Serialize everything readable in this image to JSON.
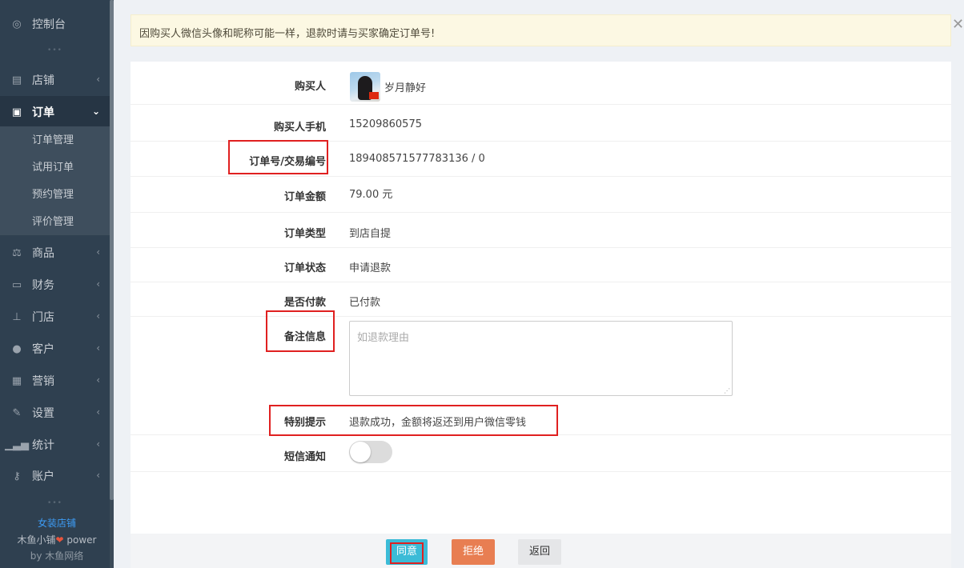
{
  "sidebar": {
    "dashboard": "控制台",
    "items": [
      {
        "label": "店铺",
        "icon": "shop-icon"
      },
      {
        "label": "订单",
        "icon": "money-icon"
      },
      {
        "label": "商品",
        "icon": "scale-icon"
      },
      {
        "label": "财务",
        "icon": "cash-icon"
      },
      {
        "label": "门店",
        "icon": "sitemap-icon"
      },
      {
        "label": "客户",
        "icon": "users-icon"
      },
      {
        "label": "营销",
        "icon": "gift-icon"
      },
      {
        "label": "设置",
        "icon": "wrench-icon"
      },
      {
        "label": "统计",
        "icon": "signal-icon"
      },
      {
        "label": "账户",
        "icon": "key-icon"
      }
    ],
    "order_submenu": [
      "订单管理",
      "试用订单",
      "预约管理",
      "评价管理"
    ],
    "store_name": "女装店铺",
    "power_prefix": "木鱼小铺",
    "power_suffix": " power",
    "by": "by 木鱼网络"
  },
  "notice": "因购买人微信头像和昵称可能一样，退款时请与买家确定订单号!",
  "form": {
    "buyer_label": "购买人",
    "buyer_name": "岁月静好",
    "phone_label": "购买人手机",
    "phone": "15209860575",
    "order_no_label": "订单号/交易编号",
    "order_no": "189408571577783136 / 0",
    "amount_label": "订单金额",
    "amount": "79.00 元",
    "type_label": "订单类型",
    "type": "到店自提",
    "status_label": "订单状态",
    "status": "申请退款",
    "paid_label": "是否付款",
    "paid": "已付款",
    "remark_label": "备注信息",
    "remark_placeholder": "如退款理由",
    "tip_label": "特别提示",
    "tip": "退款成功，金额将返还到用户微信零钱",
    "sms_label": "短信通知",
    "sms_enabled": false
  },
  "buttons": {
    "agree": "同意",
    "reject": "拒绝",
    "back": "返回"
  },
  "colors": {
    "sidebar": "#2f4050",
    "price": "#ee0000",
    "agree": "#3bbbd7",
    "reject": "#e87e52",
    "highlight": "#e02020"
  }
}
